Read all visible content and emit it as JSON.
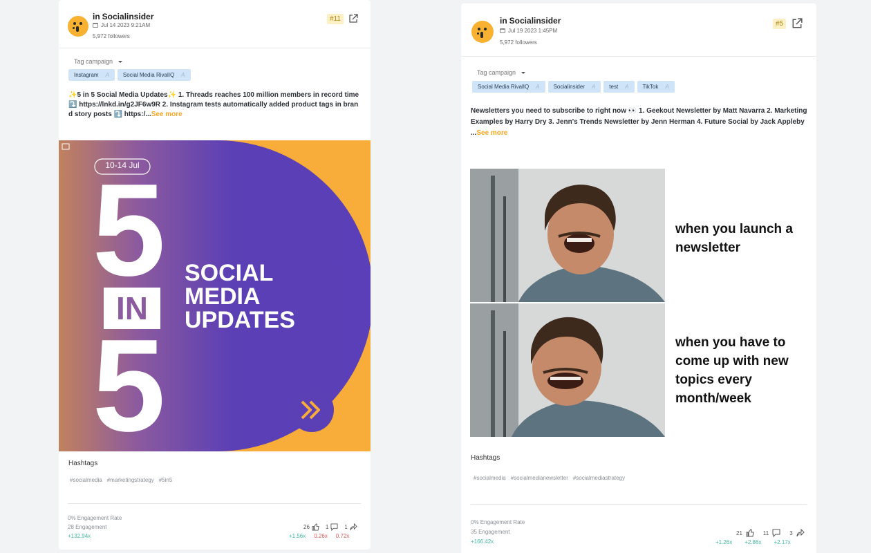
{
  "posts": [
    {
      "account": "Socialinsider",
      "network_mark": "in",
      "date": "Jul 14 2023 9:21AM",
      "followers": "5,972 followers",
      "rank": "#11",
      "tag_campaign_label": "Tag campaign",
      "tags": [
        "Instagram",
        "Social Media RivalIQ"
      ],
      "caption": "✨5 in 5 Social Media Updates✨ 1. Threads reaches 100 million members in record time ⤵️ https://lnkd.in/g2JF6w9R 2. Instagram tests automatically added product tags in brand story posts ⤵️ https:/...",
      "see_more": "See more",
      "image": {
        "date_range": "10-14 Jul",
        "big_top": "5",
        "big_mid": "IN",
        "big_bot": "5",
        "line1": "SOCIAL",
        "line2": "MEDIA",
        "line3": "UPDATES"
      },
      "hashtags_label": "Hashtags",
      "hashtags": [
        "#socialmedia",
        "#marketingstrategy",
        "#5in5"
      ],
      "engagement_rate": "0% Engagement Rate",
      "engagement": "28 Engagement",
      "engagement_growth": "+132.94x",
      "likes": "26",
      "comments": "1",
      "shares": "1",
      "likes_mult": "+1.56x",
      "comments_mult": "0.26x",
      "shares_mult": "0.72x"
    },
    {
      "account": "Socialinsider",
      "network_mark": "in",
      "date": "Jul 19 2023 1:45PM",
      "followers": "5,972 followers",
      "rank": "#5",
      "tag_campaign_label": "Tag campaign",
      "tags": [
        "Social Media RivalIQ",
        "Socialinsider",
        "test",
        "TikTok"
      ],
      "caption": "Newsletters you need to subscribe to right now 👀 1. Geekout Newsletter by Matt Navarra 2. Marketing Examples by Harry Dry 3. Jenn's Trends Newsletter by Jenn Herman 4. Future Social by Jack Appleby ...",
      "see_more": "See more",
      "image": {
        "meme_top": "when you launch a newsletter",
        "meme_bottom": "when you have to come up with new topics every month/week"
      },
      "hashtags_label": "Hashtags",
      "hashtags": [
        "#socialmedia",
        "#socialmedianewsletter",
        "#socialmediastrategy"
      ],
      "engagement_rate": "0% Engagement Rate",
      "engagement": "35 Engagement",
      "engagement_growth": "+166.42x",
      "likes": "21",
      "comments": "11",
      "shares": "3",
      "likes_mult": "+1.26x",
      "comments_mult": "+2.86x",
      "shares_mult": "+2.17x"
    }
  ],
  "colors": {
    "accent": "#f5a623",
    "tag_bg": "#cfe4f7",
    "positive": "#42b8a0",
    "negative": "#e05a5a",
    "purple": "#5b3fb5",
    "orange": "#f8ad3a"
  }
}
